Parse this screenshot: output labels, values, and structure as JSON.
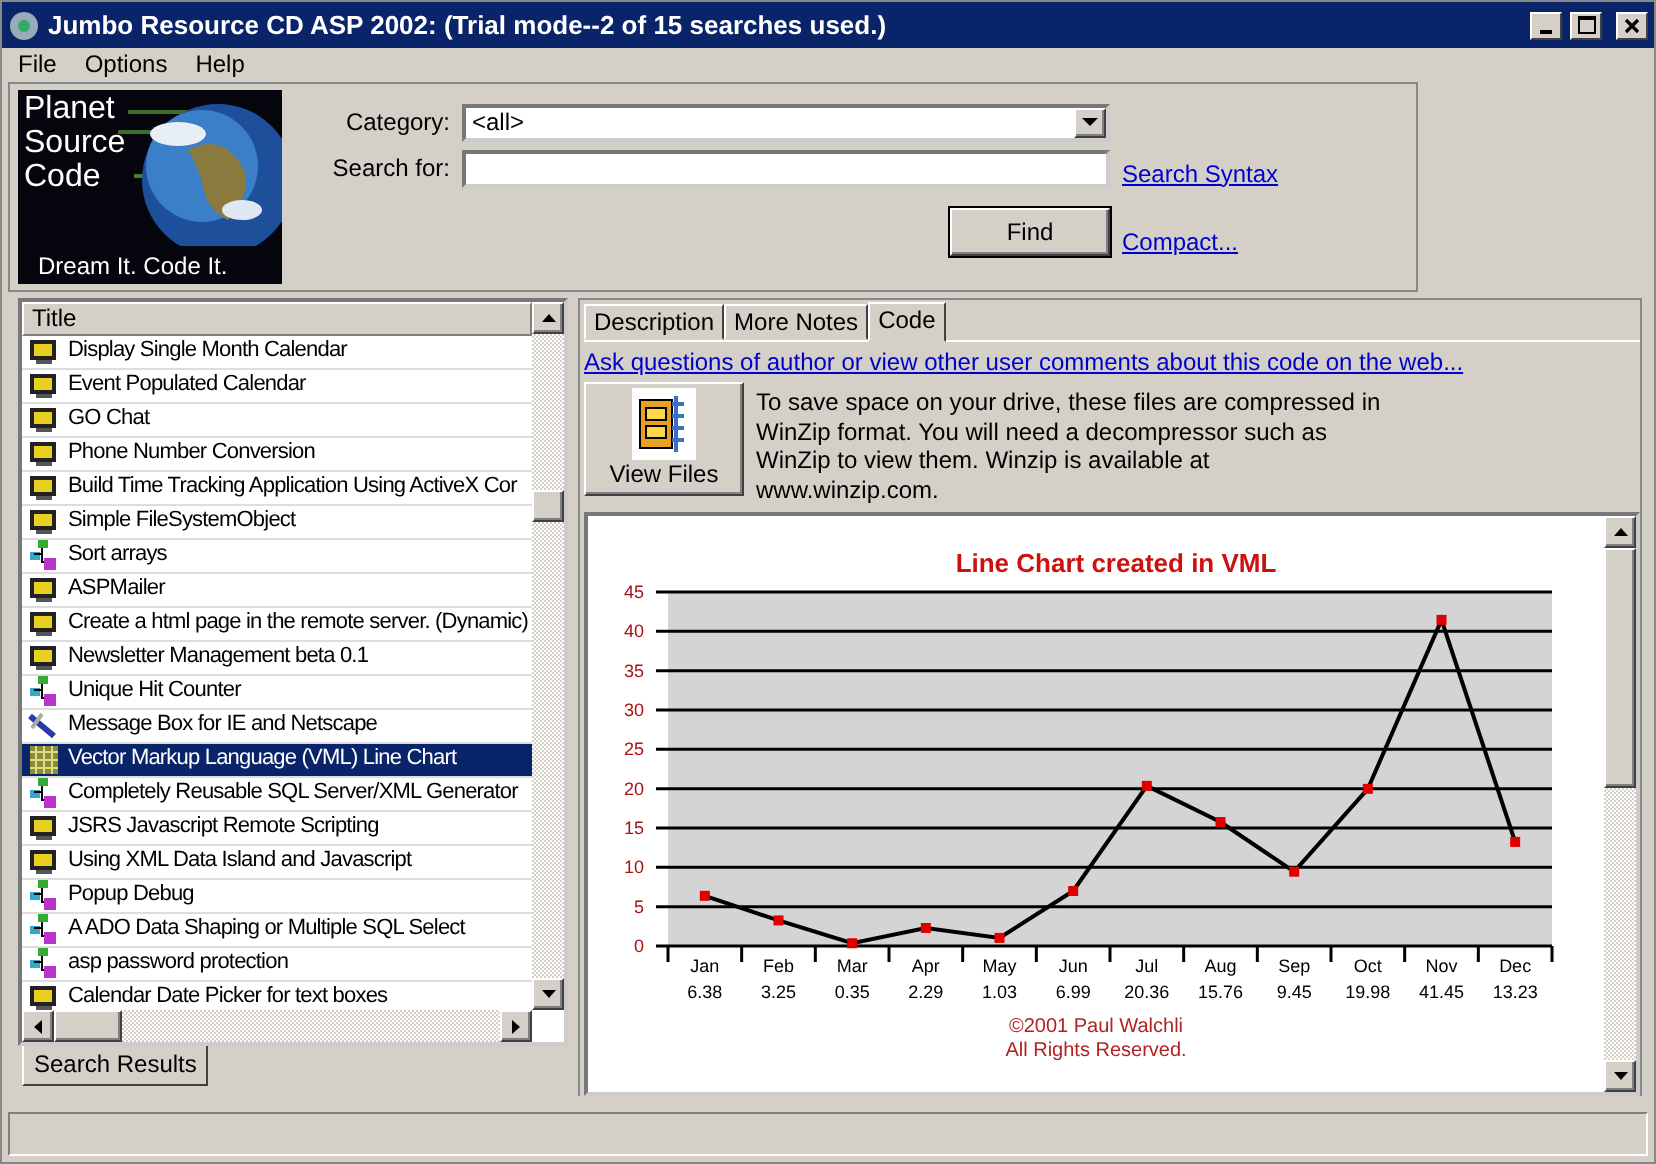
{
  "window": {
    "title": "Jumbo Resource CD ASP 2002: (Trial mode--2 of 15 searches used.)"
  },
  "menu": [
    "File",
    "Options",
    "Help"
  ],
  "header": {
    "logo": {
      "lines": [
        "Planet",
        "Source",
        "Code"
      ],
      "tagline": "Dream It.  Code It."
    },
    "category_label": "Category:",
    "category_value": "<all>",
    "search_label": "Search for:",
    "search_syntax_link": "Search Syntax",
    "find_button": "Find",
    "compact_link": "Compact..."
  },
  "results": {
    "column": "Title",
    "items": [
      {
        "title": "Display Single Month Calendar",
        "kind": "monitor",
        "selected": false
      },
      {
        "title": "Event Populated Calendar",
        "kind": "monitor",
        "selected": false
      },
      {
        "title": "GO Chat",
        "kind": "monitor",
        "selected": false
      },
      {
        "title": "Phone Number Conversion",
        "kind": "monitor",
        "selected": false
      },
      {
        "title": "Build Time Tracking Application Using ActiveX Cor",
        "kind": "monitor",
        "selected": false
      },
      {
        "title": "Simple FileSystemObject",
        "kind": "monitor",
        "selected": false
      },
      {
        "title": "Sort arrays",
        "kind": "tree",
        "selected": false
      },
      {
        "title": "ASPMailer",
        "kind": "monitor",
        "selected": false
      },
      {
        "title": "Create a html page in the remote server. (Dynamic)",
        "kind": "monitor",
        "selected": false
      },
      {
        "title": "Newsletter Management beta 0.1",
        "kind": "monitor",
        "selected": false
      },
      {
        "title": "Unique Hit Counter",
        "kind": "tree",
        "selected": false
      },
      {
        "title": "Message Box for IE and Netscape",
        "kind": "wand",
        "selected": false
      },
      {
        "title": "Vector Markup Language (VML) Line Chart",
        "kind": "grid",
        "selected": true
      },
      {
        "title": "Completely Reusable SQL Server/XML Generator",
        "kind": "tree",
        "selected": false
      },
      {
        "title": "JSRS Javascript Remote Scripting",
        "kind": "monitor",
        "selected": false
      },
      {
        "title": "Using XML Data Island and Javascript",
        "kind": "monitor",
        "selected": false
      },
      {
        "title": "Popup Debug",
        "kind": "tree",
        "selected": false
      },
      {
        "title": "A ADO Data Shaping or Multiple SQL Select",
        "kind": "tree",
        "selected": false
      },
      {
        "title": "asp password protection",
        "kind": "tree",
        "selected": false
      },
      {
        "title": "Calendar Date Picker for text boxes",
        "kind": "monitor",
        "selected": false
      }
    ],
    "tab": "Search Results"
  },
  "detail": {
    "tabs": [
      {
        "label": "Description",
        "selected": false
      },
      {
        "label": "More Notes",
        "selected": false
      },
      {
        "label": "Code",
        "selected": true
      }
    ],
    "web_link": "Ask questions of author or view other user comments about this code on the web...",
    "view_files_button": "View Files",
    "note": "To save space on your drive, these files are compressed in WinZip format.  You will need a decompressor such as WinZip to view them.  Winzip is available at www.winzip.com.",
    "chart_data": {
      "type": "line",
      "title": "Line Chart created in VML",
      "categories": [
        "Jan",
        "Feb",
        "Mar",
        "Apr",
        "May",
        "Jun",
        "Jul",
        "Aug",
        "Sep",
        "Oct",
        "Nov",
        "Dec"
      ],
      "values": [
        6.38,
        3.25,
        0.35,
        2.29,
        1.03,
        6.99,
        20.36,
        15.76,
        9.45,
        19.98,
        41.45,
        13.23
      ],
      "color": "#000000",
      "marker": "square",
      "grid": true,
      "value_labels": [
        "6.38",
        "3.25",
        "0.35",
        "2.29",
        "1.03",
        "6.99",
        "20.36",
        "15.76",
        "9.45",
        "19.98",
        "41.45",
        "13.23"
      ],
      "ylim": [
        0,
        45
      ],
      "yticks": [
        0,
        5,
        10,
        15,
        20,
        25,
        30,
        35,
        40,
        45
      ]
    },
    "copyright": [
      "©2001 Paul Walchli",
      "All Rights Reserved."
    ]
  }
}
